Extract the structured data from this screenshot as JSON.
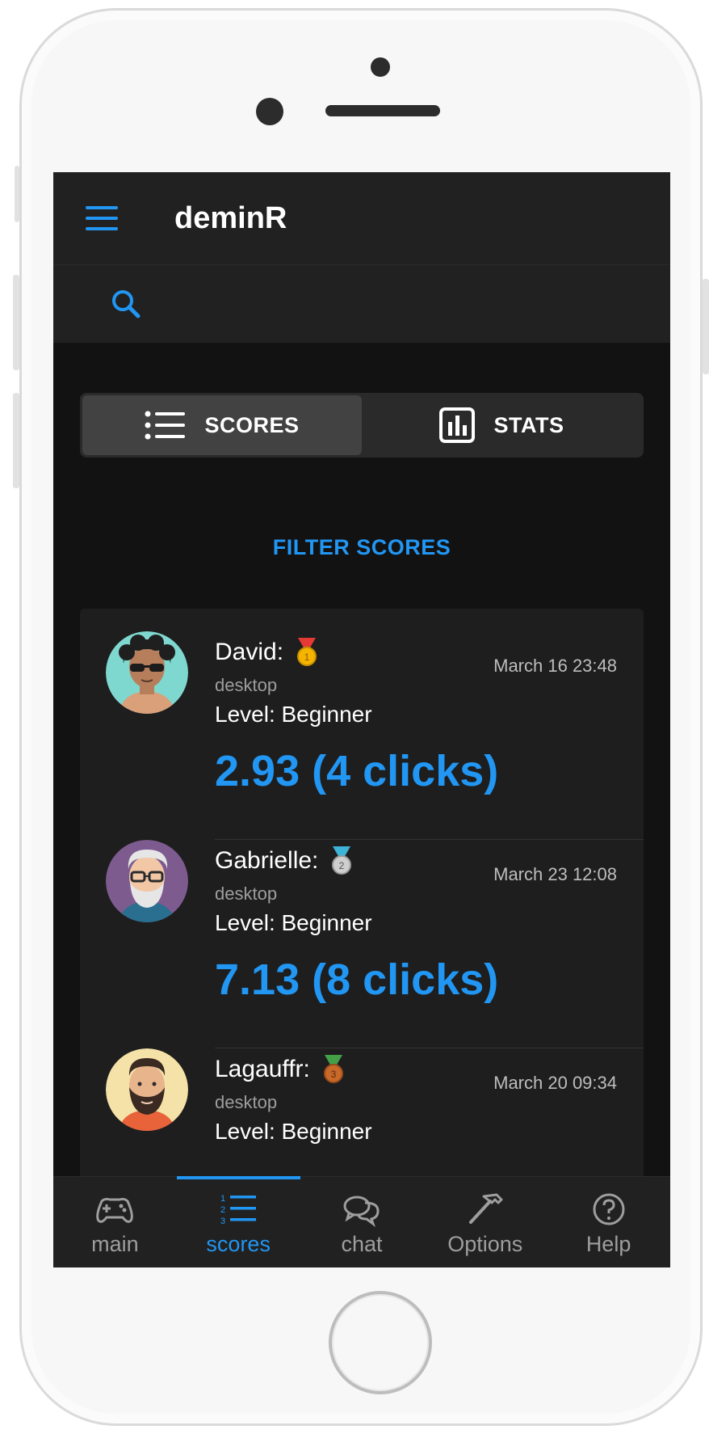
{
  "app": {
    "title": "deminR"
  },
  "search": {
    "icon": "search-icon"
  },
  "toggle": {
    "scores_label": "SCORES",
    "stats_label": "STATS",
    "active": "scores"
  },
  "filter_label": "FILTER SCORES",
  "scores": [
    {
      "name": "David:",
      "medal": "gold",
      "device": "desktop",
      "level": "Level: Beginner",
      "date": "March 16 23:48",
      "score": "2.93 (4 clicks)"
    },
    {
      "name": "Gabrielle:",
      "medal": "silver",
      "device": "desktop",
      "level": "Level: Beginner",
      "date": "March 23 12:08",
      "score": "7.13 (8 clicks)"
    },
    {
      "name": "Lagauffr:",
      "medal": "bronze",
      "device": "desktop",
      "level": "Level: Beginner",
      "date": "March 20 09:34",
      "score": ""
    }
  ],
  "nav": {
    "items": [
      {
        "label": "main",
        "icon": "gamepad-icon"
      },
      {
        "label": "scores",
        "icon": "list-numbered-icon"
      },
      {
        "label": "chat",
        "icon": "chat-icon"
      },
      {
        "label": "Options",
        "icon": "hammer-icon"
      },
      {
        "label": "Help",
        "icon": "help-icon"
      }
    ],
    "active": "scores"
  },
  "colors": {
    "accent": "#2196f3",
    "background": "#121212",
    "appbar": "#212121",
    "card": "#1e1e1e"
  }
}
